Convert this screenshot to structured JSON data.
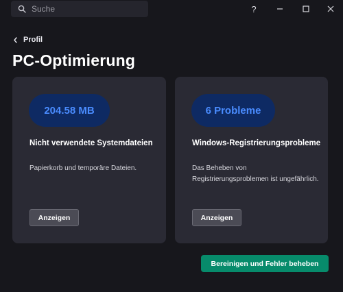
{
  "search": {
    "placeholder": "Suche"
  },
  "window_controls": {
    "help": "?",
    "minimize": "–",
    "maximize": "□",
    "close": "✕"
  },
  "breadcrumb": {
    "back_label": "Profil"
  },
  "page": {
    "title": "PC-Optimierung"
  },
  "cards": [
    {
      "value": "204.58 MB",
      "title": "Nicht verwendete Systemdateien",
      "description": "Papierkorb und temporäre Dateien.",
      "button": "Anzeigen"
    },
    {
      "value": "6 Probleme",
      "title": "Windows-Registrierungsprobleme",
      "description": "Das Beheben von Registrierungsproblemen ist ungefährlich.",
      "button": "Anzeigen"
    }
  ],
  "actions": {
    "primary": "Bereinigen und Fehler beheben"
  },
  "colors": {
    "background": "#17171c",
    "card": "#2a2a34",
    "value_pill_bg": "#0e2a63",
    "value_pill_text": "#4a8cff",
    "primary_button": "#078b6b"
  }
}
